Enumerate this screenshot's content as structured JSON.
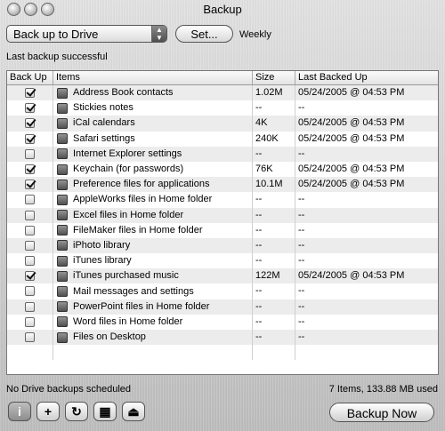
{
  "window": {
    "title": "Backup"
  },
  "destination": {
    "selected": "Back up to Drive"
  },
  "set_button": {
    "label": "Set..."
  },
  "schedule_text": "Weekly",
  "status": "Last backup successful",
  "table": {
    "headers": {
      "backup": "Back Up",
      "items": "Items",
      "size": "Size",
      "last": "Last Backed Up"
    },
    "rows": [
      {
        "checked": true,
        "name": "Address Book contacts",
        "size": "1.02M",
        "last": "05/24/2005 @ 04:53 PM"
      },
      {
        "checked": true,
        "name": "Stickies notes",
        "size": "--",
        "last": "--"
      },
      {
        "checked": true,
        "name": "iCal calendars",
        "size": "4K",
        "last": "05/24/2005 @ 04:53 PM"
      },
      {
        "checked": true,
        "name": "Safari settings",
        "size": "240K",
        "last": "05/24/2005 @ 04:53 PM"
      },
      {
        "checked": false,
        "name": "Internet Explorer settings",
        "size": "--",
        "last": "--"
      },
      {
        "checked": true,
        "name": "Keychain (for passwords)",
        "size": "76K",
        "last": "05/24/2005 @ 04:53 PM"
      },
      {
        "checked": true,
        "name": "Preference files for applications",
        "size": "10.1M",
        "last": "05/24/2005 @ 04:53 PM"
      },
      {
        "checked": false,
        "name": "AppleWorks files in Home folder",
        "size": "--",
        "last": "--"
      },
      {
        "checked": false,
        "name": "Excel files in Home folder",
        "size": "--",
        "last": "--"
      },
      {
        "checked": false,
        "name": "FileMaker files in Home folder",
        "size": "--",
        "last": "--"
      },
      {
        "checked": false,
        "name": "iPhoto library",
        "size": "--",
        "last": "--"
      },
      {
        "checked": false,
        "name": "iTunes library",
        "size": "--",
        "last": "--"
      },
      {
        "checked": true,
        "name": "iTunes purchased music",
        "size": "122M",
        "last": "05/24/2005 @ 04:53 PM"
      },
      {
        "checked": false,
        "name": "Mail messages and settings",
        "size": "--",
        "last": "--"
      },
      {
        "checked": false,
        "name": "PowerPoint files in Home folder",
        "size": "--",
        "last": "--"
      },
      {
        "checked": false,
        "name": "Word files in Home folder",
        "size": "--",
        "last": "--"
      },
      {
        "checked": false,
        "name": "Files on Desktop",
        "size": "--",
        "last": "--"
      }
    ]
  },
  "footer": {
    "left": "No Drive backups scheduled",
    "right": "7 Items, 133.88 MB used"
  },
  "toolbar": {
    "info_icon": "info-icon",
    "add_icon": "plus-icon",
    "refresh_icon": "refresh-icon",
    "calculator_icon": "calculator-icon",
    "eject_icon": "eject-icon"
  },
  "backup_now": {
    "label": "Backup Now"
  }
}
